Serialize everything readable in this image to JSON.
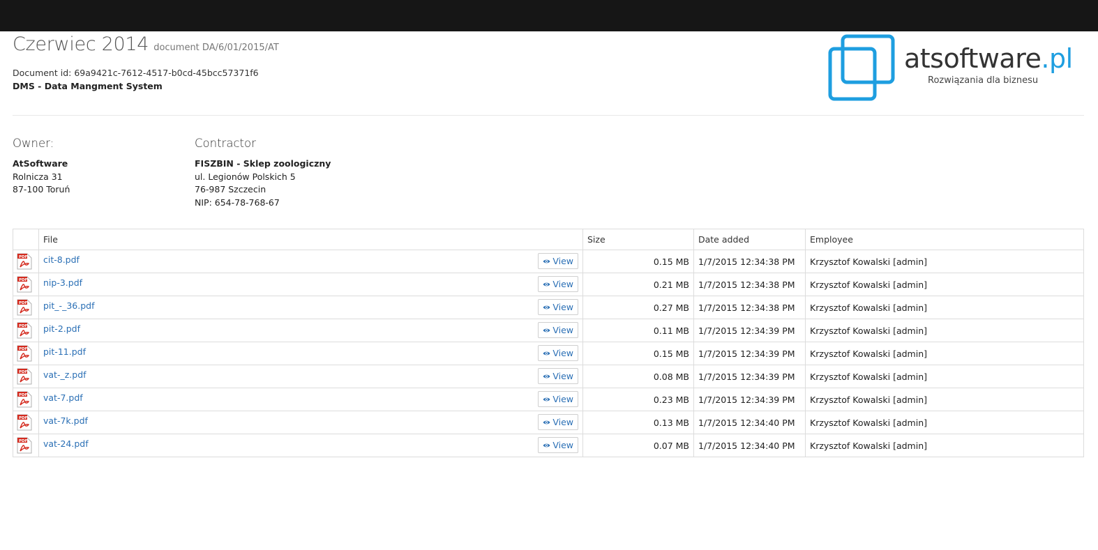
{
  "header": {
    "title": "Czerwiec 2014",
    "subtitle": "document DA/6/01/2015/AT",
    "document_id": "Document id: 69a9421c-7612-4517-b0cd-45bcc57371f6",
    "system_name": "DMS - Data Mangment System"
  },
  "logo": {
    "name": "atsoftware",
    "tld": ".pl",
    "tagline": "Rozwiązania dla biznesu",
    "accent_color": "#1e9ee0"
  },
  "owner": {
    "heading": "Owner:",
    "name": "AtSoftware",
    "street": "Rolnicza 31",
    "city": "87-100 Toruń"
  },
  "contractor": {
    "heading": "Contractor",
    "name": "FISZBIN - Sklep zoologiczny",
    "street": "ul. Legionów Polskich 5",
    "city": "76-987 Szczecin",
    "nip": "NIP: 654-78-768-67"
  },
  "table": {
    "columns": [
      "",
      "File",
      "Size",
      "Date added",
      "Employee"
    ],
    "view_label": "View",
    "rows": [
      {
        "file": "cit-8.pdf",
        "size": "0.15 MB",
        "date": "1/7/2015 12:34:38 PM",
        "employee": "Krzysztof Kowalski [admin]"
      },
      {
        "file": "nip-3.pdf",
        "size": "0.21 MB",
        "date": "1/7/2015 12:34:38 PM",
        "employee": "Krzysztof Kowalski [admin]"
      },
      {
        "file": "pit_-_36.pdf",
        "size": "0.27 MB",
        "date": "1/7/2015 12:34:38 PM",
        "employee": "Krzysztof Kowalski [admin]"
      },
      {
        "file": "pit-2.pdf",
        "size": "0.11 MB",
        "date": "1/7/2015 12:34:39 PM",
        "employee": "Krzysztof Kowalski [admin]"
      },
      {
        "file": "pit-11.pdf",
        "size": "0.15 MB",
        "date": "1/7/2015 12:34:39 PM",
        "employee": "Krzysztof Kowalski [admin]"
      },
      {
        "file": "vat-_z.pdf",
        "size": "0.08 MB",
        "date": "1/7/2015 12:34:39 PM",
        "employee": "Krzysztof Kowalski [admin]"
      },
      {
        "file": "vat-7.pdf",
        "size": "0.23 MB",
        "date": "1/7/2015 12:34:39 PM",
        "employee": "Krzysztof Kowalski [admin]"
      },
      {
        "file": "vat-7k.pdf",
        "size": "0.13 MB",
        "date": "1/7/2015 12:34:40 PM",
        "employee": "Krzysztof Kowalski [admin]"
      },
      {
        "file": "vat-24.pdf",
        "size": "0.07 MB",
        "date": "1/7/2015 12:34:40 PM",
        "employee": "Krzysztof Kowalski [admin]"
      }
    ]
  }
}
